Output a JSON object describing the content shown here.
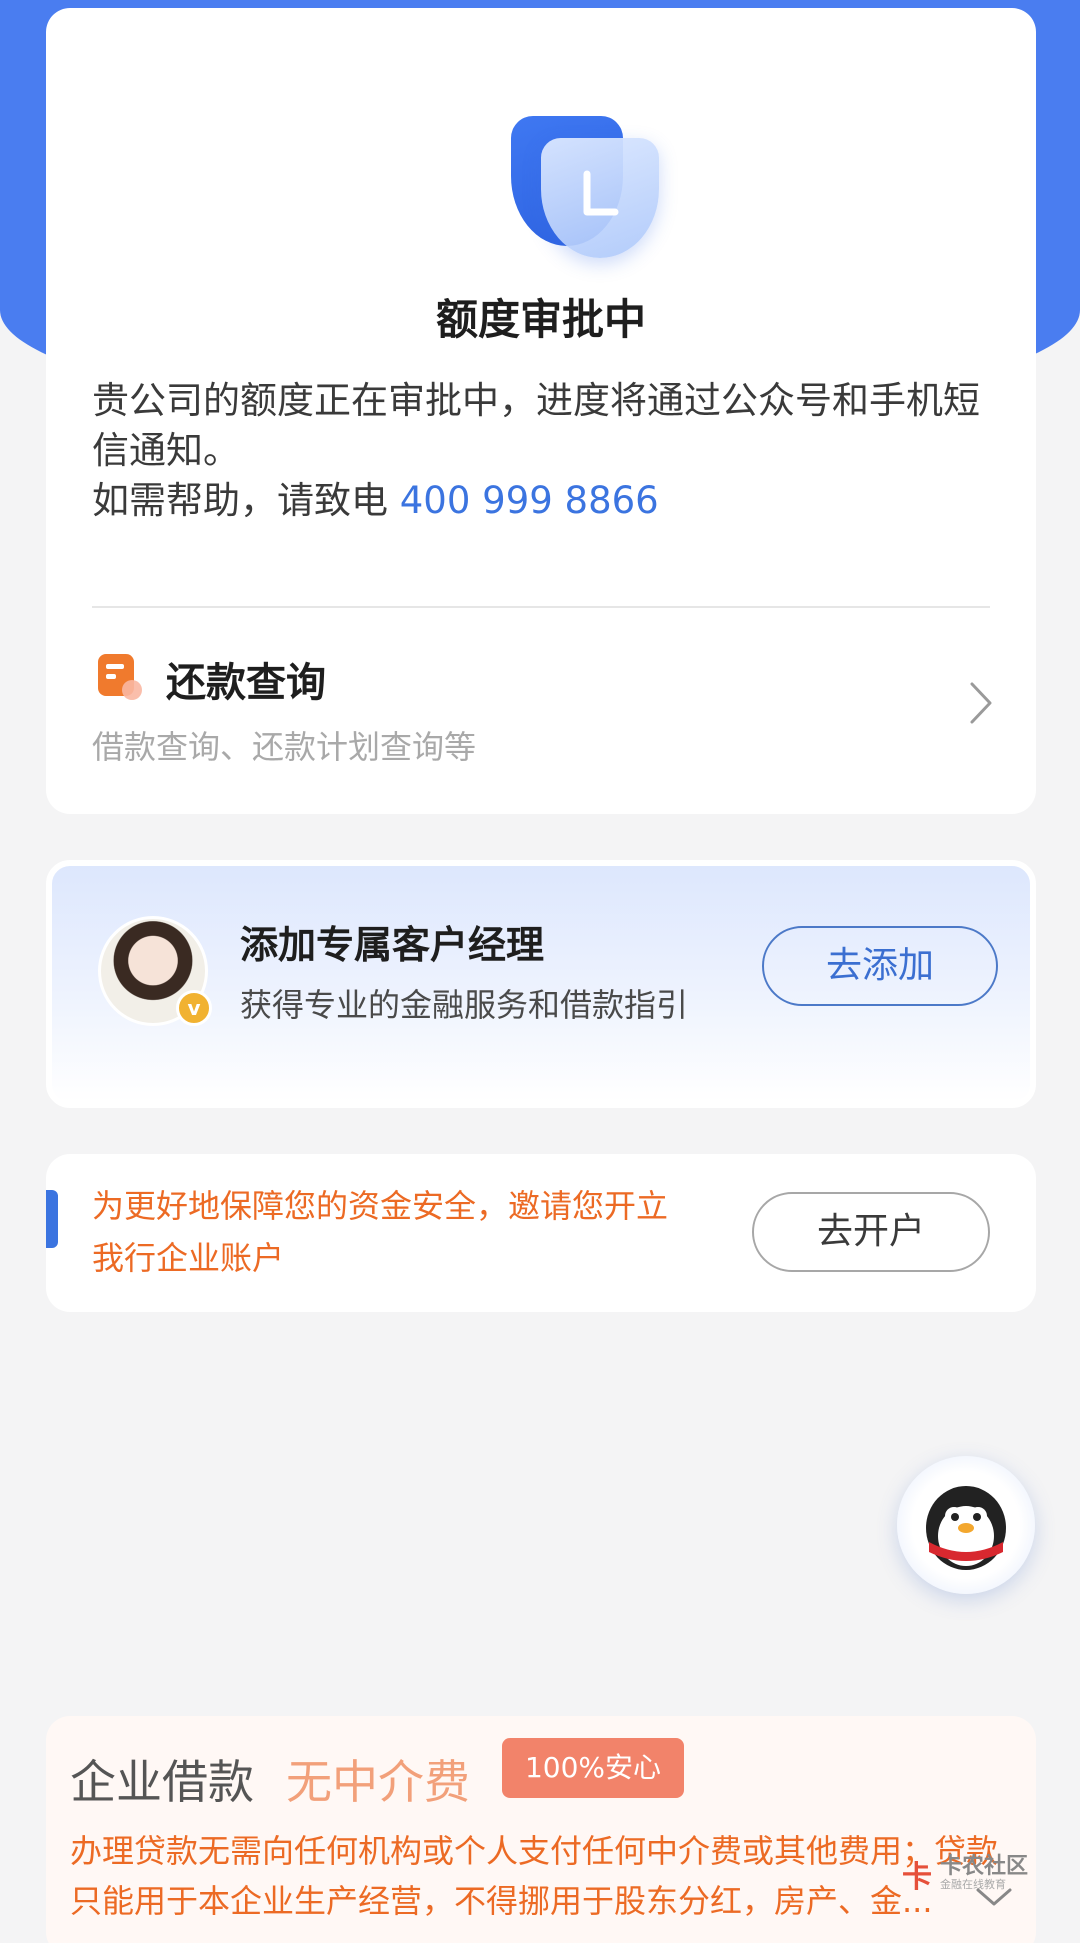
{
  "status": {
    "title": "额度审批中",
    "desc_line": "贵公司的额度正在审批中，进度将通过公众号和手机短信通知。",
    "help_prefix": "如需帮助，请致电 ",
    "phone": "400 999 8866",
    "shield_letter": "L"
  },
  "repay": {
    "title": "还款查询",
    "subtitle": "借款查询、还款计划查询等"
  },
  "manager": {
    "title": "添加专属客户经理",
    "subtitle": "获得专业的金融服务和借款指引",
    "button": "去添加",
    "badge": "v"
  },
  "account": {
    "notice": "为更好地保障您的资金安全，邀请您开立我行企业账户",
    "button": "去开户"
  },
  "loan": {
    "heading": "企业借款",
    "highlight": "无中介费",
    "badge": "100%安心",
    "text": "办理贷款无需向任何机构或个人支付任何中介费或其他费用；贷款只能用于本企业生产经营，不得挪用于股东分红，房产、金..."
  },
  "watermark": {
    "name": "卡农社区",
    "sub": "金融在线教育",
    "logo": "卡"
  },
  "colors": {
    "primary_blue": "#4a7df0",
    "link_blue": "#3b74e0",
    "orange_text": "#ec6a24",
    "badge_red": "#f2836a"
  }
}
